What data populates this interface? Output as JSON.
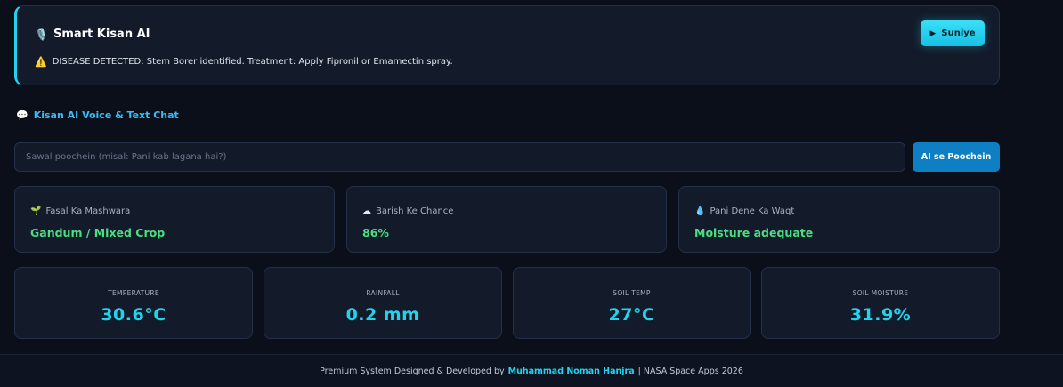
{
  "ai_card": {
    "title": "Smart Kisan AI",
    "mic_icon": "🎙️",
    "message": "DISEASE DETECTED: Stem Borer identified. Treatment: Apply Fipronil or Emamectin spray.",
    "warning_icon": "⚠️",
    "listen_button": {
      "icon": "▶",
      "label": "Suniye"
    },
    "accent_color": "#22d3ee"
  },
  "chat": {
    "icon": "💬",
    "title": "Kisan AI Voice & Text Chat",
    "input_placeholder": "Sawal poochein (misal: Pani kab lagana hai?)",
    "input_value": "",
    "ask_button": "AI se Poochein"
  },
  "info_cards": [
    {
      "icon": "🌱",
      "icon_name": "sprout-icon",
      "label": "Fasal Ka Mashwara",
      "value": "Gandum / Mixed Crop"
    },
    {
      "icon": "☁",
      "icon_name": "cloud-icon",
      "label": "Barish Ke Chance",
      "value": "86%"
    },
    {
      "icon": "💧",
      "icon_name": "droplet-icon",
      "label": "Pani Dene Ka Waqt",
      "value": "Moisture adequate"
    }
  ],
  "metrics": [
    {
      "label": "TEMPERATURE",
      "value": "30.6°C"
    },
    {
      "label": "RAINFALL",
      "value": "0.2 mm"
    },
    {
      "label": "SOIL TEMP",
      "value": "27°C"
    },
    {
      "label": "SOIL MOISTURE",
      "value": "31.9%"
    }
  ],
  "footer": {
    "prefix": "Premium System Designed & Developed by",
    "author": "Muhammad Noman Hanjra",
    "suffix": "| NASA Space Apps 2026"
  },
  "colors": {
    "background": "#0a0f1a",
    "card": "#131b2b",
    "accent": "#22d3ee",
    "value_green": "#4ade80",
    "button_blue": "#0f7fc4"
  }
}
